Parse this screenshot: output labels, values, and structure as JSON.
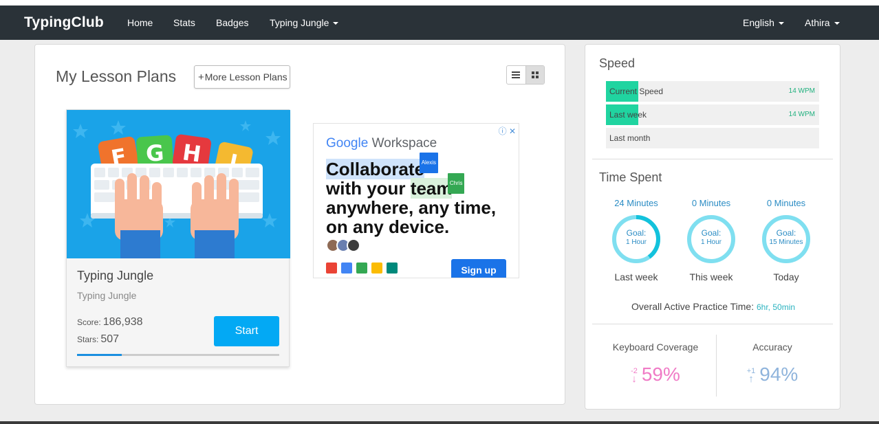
{
  "navbar": {
    "brand": "TypingClub",
    "links": [
      "Home",
      "Stats",
      "Badges",
      "Typing Jungle"
    ],
    "language": "English",
    "user": "Athira"
  },
  "main": {
    "title": "My Lesson Plans",
    "more_button": "More Lesson Plans",
    "card": {
      "title": "Typing Jungle",
      "subtitle": "Typing Jungle",
      "score_label": "Score:",
      "score": "186,938",
      "stars_label": "Stars:",
      "stars": "507",
      "start": "Start",
      "progress": 0.22,
      "letters": [
        "F",
        "G",
        "H",
        "J"
      ]
    }
  },
  "ad": {
    "brand_google": "Google",
    "brand_workspace": "Workspace",
    "line1": "Collaborate",
    "line2_a": "with your ",
    "line2_b": "team",
    "line3": "anywhere, any time,",
    "line4": "on any device.",
    "tag1": "Alexis",
    "tag2": "Chris",
    "cta": "Sign up"
  },
  "speed": {
    "title": "Speed",
    "rows": [
      {
        "label": "Current Speed",
        "value": "14 WPM",
        "fill": 0.15
      },
      {
        "label": "Last week",
        "value": "14 WPM",
        "fill": 0.15
      },
      {
        "label": "Last month",
        "value": "",
        "fill": 0
      }
    ]
  },
  "time_spent": {
    "title": "Time Spent",
    "cols": [
      {
        "minutes": "24 Minutes",
        "goal": "Goal:",
        "target": "1 Hour",
        "label": "Last week",
        "progress": 0.4
      },
      {
        "minutes": "0 Minutes",
        "goal": "Goal:",
        "target": "1 Hour",
        "label": "This week",
        "progress": 0
      },
      {
        "minutes": "0 Minutes",
        "goal": "Goal:",
        "target": "15 Minutes",
        "label": "Today",
        "progress": 0
      }
    ],
    "overall_label": "Overall Active Practice Time:",
    "overall_value": "6hr, 50min"
  },
  "metrics": {
    "coverage_title": "Keyboard Coverage",
    "coverage_delta": "-2",
    "coverage_value": "59%",
    "accuracy_title": "Accuracy",
    "accuracy_delta": "+1",
    "accuracy_value": "94%"
  },
  "colors": {
    "navbar": "#2a3238",
    "accent": "#03a9f4",
    "speed_fill": "#20d4a0",
    "ring": "#7fdff0",
    "ring_progress": "#13c2dc",
    "coverage": "#f07bc6",
    "accuracy": "#8fb4dc"
  }
}
